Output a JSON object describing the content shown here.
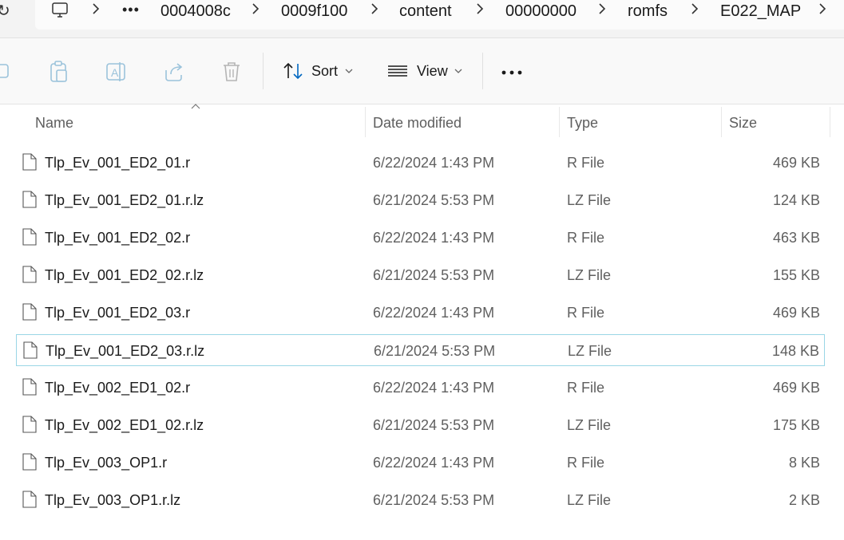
{
  "breadcrumb": {
    "items": [
      "0004008c",
      "0009f100",
      "content",
      "00000000",
      "romfs",
      "E022_MAP"
    ]
  },
  "toolbar": {
    "sort_label": "Sort",
    "view_label": "View"
  },
  "columns": {
    "name": "Name",
    "date": "Date modified",
    "type": "Type",
    "size": "Size"
  },
  "files": [
    {
      "name": "Tlp_Ev_001_ED2_01.r",
      "date": "6/22/2024 1:43 PM",
      "type": "R File",
      "size": "469 KB"
    },
    {
      "name": "Tlp_Ev_001_ED2_01.r.lz",
      "date": "6/21/2024 5:53 PM",
      "type": "LZ File",
      "size": "124 KB"
    },
    {
      "name": "Tlp_Ev_001_ED2_02.r",
      "date": "6/22/2024 1:43 PM",
      "type": "R File",
      "size": "463 KB"
    },
    {
      "name": "Tlp_Ev_001_ED2_02.r.lz",
      "date": "6/21/2024 5:53 PM",
      "type": "LZ File",
      "size": "155 KB"
    },
    {
      "name": "Tlp_Ev_001_ED2_03.r",
      "date": "6/22/2024 1:43 PM",
      "type": "R File",
      "size": "469 KB"
    },
    {
      "name": "Tlp_Ev_001_ED2_03.r.lz",
      "date": "6/21/2024 5:53 PM",
      "type": "LZ File",
      "size": "148 KB"
    },
    {
      "name": "Tlp_Ev_002_ED1_02.r",
      "date": "6/22/2024 1:43 PM",
      "type": "R File",
      "size": "469 KB"
    },
    {
      "name": "Tlp_Ev_002_ED1_02.r.lz",
      "date": "6/21/2024 5:53 PM",
      "type": "LZ File",
      "size": "175 KB"
    },
    {
      "name": "Tlp_Ev_003_OP1.r",
      "date": "6/22/2024 1:43 PM",
      "type": "R File",
      "size": "8 KB"
    },
    {
      "name": "Tlp_Ev_003_OP1.r.lz",
      "date": "6/21/2024 5:53 PM",
      "type": "LZ File",
      "size": "2 KB"
    }
  ],
  "selected_index": 5,
  "colors": {
    "selection_border": "#9ad6e6",
    "accent": "#0067c0"
  }
}
